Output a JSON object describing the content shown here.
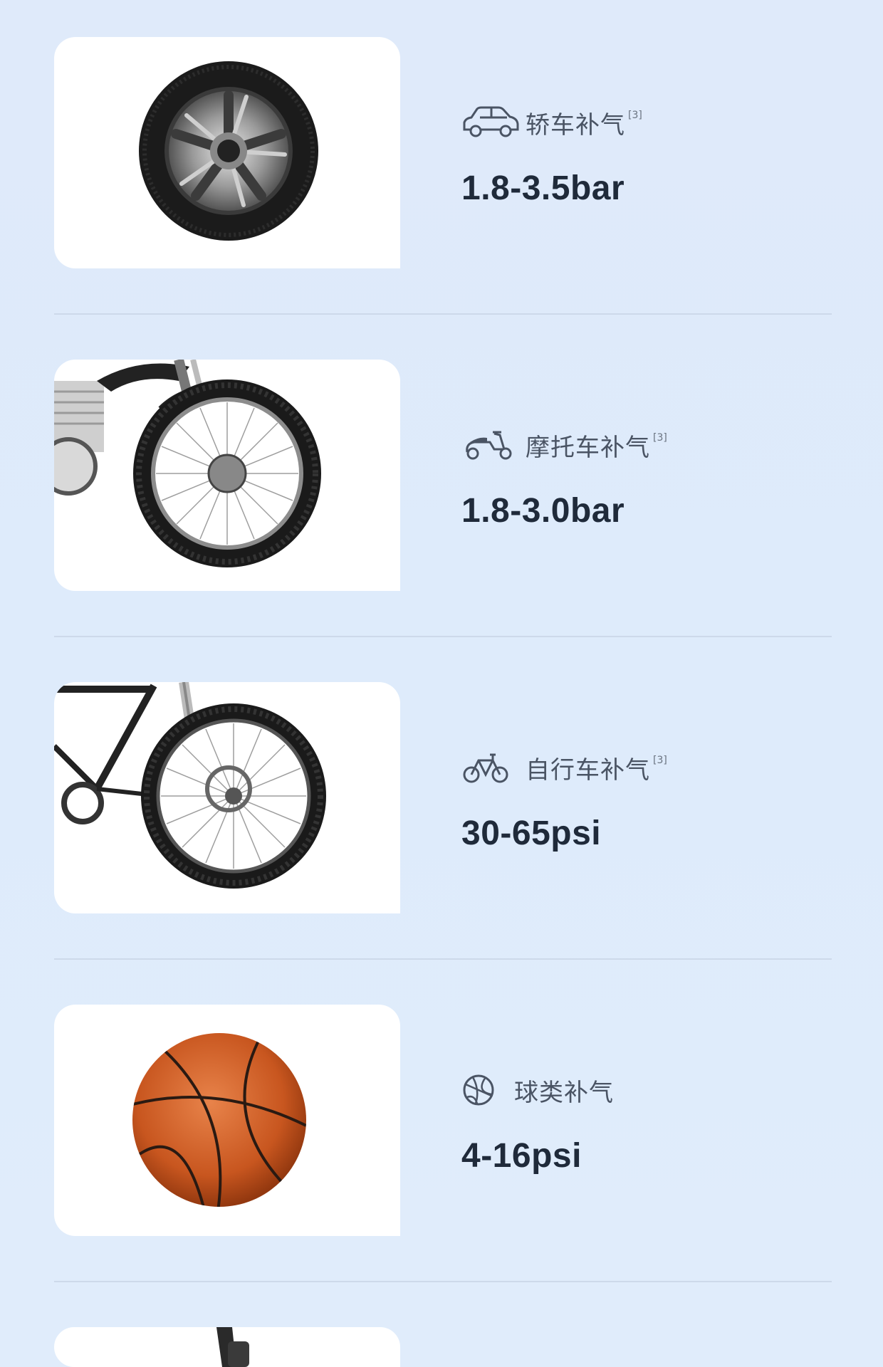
{
  "items": [
    {
      "icon": "car-icon",
      "label": "轿车补气",
      "ref": "[3]",
      "value": "1.8-3.5bar",
      "image": "car-wheel-image"
    },
    {
      "icon": "motorcycle-icon",
      "label": "摩托车补气",
      "ref": "[3]",
      "value": "1.8-3.0bar",
      "image": "motorcycle-wheel-image"
    },
    {
      "icon": "bicycle-icon",
      "label": "自行车补气",
      "ref": "[3]",
      "value": "30-65psi",
      "image": "bicycle-wheel-image"
    },
    {
      "icon": "basketball-icon",
      "label": "球类补气",
      "ref": "",
      "value": "4-16psi",
      "image": "basketball-image"
    }
  ],
  "colors": {
    "background": "#dfeafa",
    "card": "#ffffff",
    "text": "#1f2a3a",
    "label": "#4a5464",
    "divider": "#cdd9ea"
  }
}
